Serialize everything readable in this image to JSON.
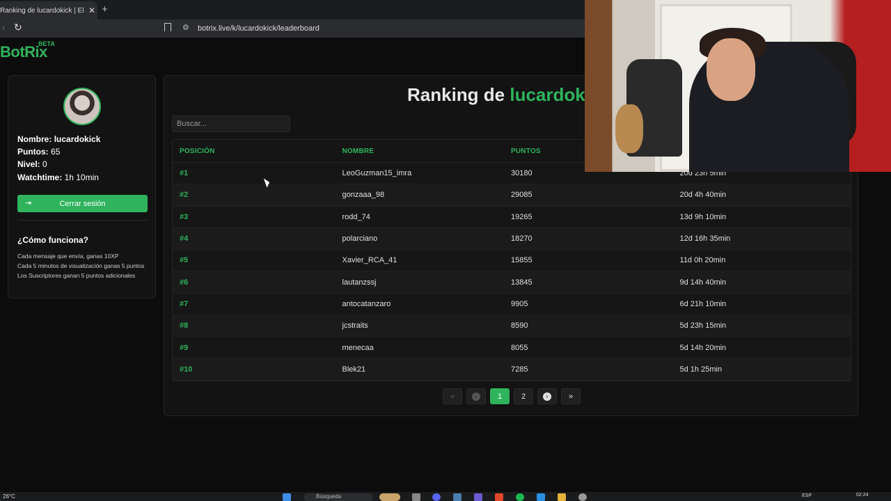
{
  "browser": {
    "tab_title": "Ranking de lucardokick | El mejo",
    "close_glyph": "✕",
    "new_tab_glyph": "+",
    "url": "botrix.live/k/lucardokick/leaderboard"
  },
  "logo": {
    "text": "BotRix",
    "badge": "BETA"
  },
  "profile": {
    "name_label": "Nombre:",
    "name_value": "lucardokick",
    "points_label": "Puntos:",
    "points_value": "65",
    "level_label": "Nivel:",
    "level_value": "0",
    "watchtime_label": "Watchtime:",
    "watchtime_value": "1h 10min",
    "logout_label": "Cerrar sesión"
  },
  "how": {
    "title": "¿Cómo funciona?",
    "items": [
      "Cada mensaje que envía, ganas 10XP",
      "Cada 5 minutos de visualización ganas 5 puntos",
      "Los Suscriptores ganan 5 puntos adicionales"
    ]
  },
  "ranking": {
    "title_prefix": "Ranking de ",
    "title_highlight": "lucardokick",
    "search_placeholder": "Buscar...",
    "headers": [
      "POSICIÓN",
      "NOMBRE",
      "PUNTOS",
      ""
    ],
    "rows": [
      {
        "pos": "#1",
        "name": "LeoGuzman15_imra",
        "points": "30180",
        "time": "20d 23h 5min"
      },
      {
        "pos": "#2",
        "name": "gonzaaa_98",
        "points": "29085",
        "time": "20d 4h 40min"
      },
      {
        "pos": "#3",
        "name": "rodd_74",
        "points": "19265",
        "time": "13d 9h 10min"
      },
      {
        "pos": "#4",
        "name": "polarciano",
        "points": "18270",
        "time": "12d 16h 35min"
      },
      {
        "pos": "#5",
        "name": "Xavier_RCA_41",
        "points": "15855",
        "time": "11d 0h 20min"
      },
      {
        "pos": "#6",
        "name": "lautanzssj",
        "points": "13845",
        "time": "9d 14h 40min"
      },
      {
        "pos": "#7",
        "name": "antocatanzaro",
        "points": "9905",
        "time": "6d 21h 10min"
      },
      {
        "pos": "#8",
        "name": "jcstraits",
        "points": "8590",
        "time": "5d 23h 15min"
      },
      {
        "pos": "#9",
        "name": "menecaa",
        "points": "8055",
        "time": "5d 14h 20min"
      },
      {
        "pos": "#10",
        "name": "Blek21",
        "points": "7285",
        "time": "5d 1h 25min"
      }
    ]
  },
  "pagination": {
    "first": "«",
    "prev": "‹",
    "pages": [
      "1",
      "2"
    ],
    "next": "›",
    "last": "»",
    "current": "1"
  },
  "taskbar": {
    "weather": "26°C",
    "search_placeholder": "Búsqueda",
    "lang": "ESP",
    "time": "02:24"
  },
  "colors": {
    "accent": "#2fb35d",
    "background": "#0b0c0b",
    "panel": "#121312"
  }
}
